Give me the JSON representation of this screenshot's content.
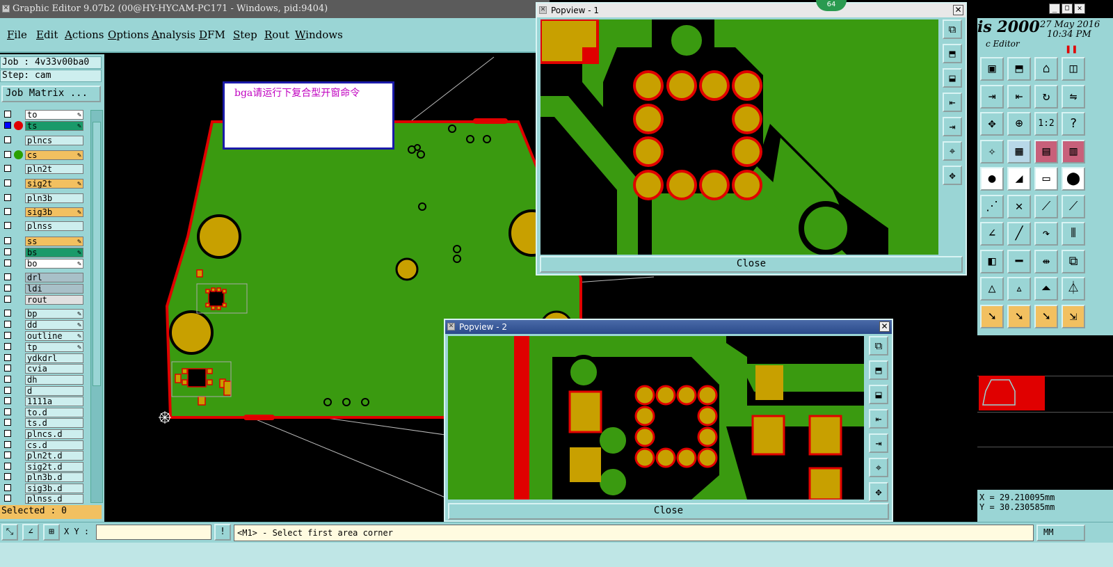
{
  "app": {
    "title": "Graphic Editor 9.07b2 (00@HY-HYCAM-PC171 - Windows, pid:9404)",
    "brand_fragment": "is 2000",
    "brand_sub": "c Editor",
    "date": "27 May 2016",
    "time": "10:34 PM",
    "badge": "64"
  },
  "menu": [
    "File",
    "Edit",
    "Actions",
    "Options",
    "Analysis",
    "DFM",
    "Step",
    "Rout",
    "Windows"
  ],
  "job": {
    "job_label": "Job : 4v33v00ba0",
    "step_label": "Step: cam",
    "matrix_button": "Job Matrix ..."
  },
  "layers": [
    {
      "name": "to",
      "color": "#ffffff",
      "edit": true,
      "dot": ""
    },
    {
      "name": "ts",
      "color": "#1a9a6a",
      "edit": true,
      "dot": "#e00000",
      "selected": true
    },
    {
      "name": "plncs",
      "color": "#cdeeee",
      "edit": false,
      "dot": ""
    },
    {
      "name": "cs",
      "color": "#f2c060",
      "edit": true,
      "dot": "#2aa000"
    },
    {
      "name": "pln2t",
      "color": "#cdeeee",
      "edit": false,
      "dot": ""
    },
    {
      "name": "sig2t",
      "color": "#f2c060",
      "edit": true,
      "dot": ""
    },
    {
      "name": "pln3b",
      "color": "#cdeeee",
      "edit": false,
      "dot": ""
    },
    {
      "name": "sig3b",
      "color": "#f2c060",
      "edit": true,
      "dot": ""
    },
    {
      "name": "plnss",
      "color": "#cdeeee",
      "edit": false,
      "dot": ""
    },
    {
      "name": "ss",
      "color": "#f2c060",
      "edit": true,
      "dot": ""
    },
    {
      "name": "bs",
      "color": "#1a9a6a",
      "edit": true,
      "dot": ""
    },
    {
      "name": "bo",
      "color": "#ffffff",
      "edit": true,
      "dot": ""
    },
    {
      "name": "drl",
      "color": "#a8c0c8",
      "edit": false,
      "dot": ""
    },
    {
      "name": "ldi",
      "color": "#a8c0c8",
      "edit": false,
      "dot": ""
    },
    {
      "name": "rout",
      "color": "#e0e0e0",
      "edit": false,
      "dot": ""
    },
    {
      "name": "bp",
      "color": "#cdeeee",
      "edit": true,
      "dot": ""
    },
    {
      "name": "dd",
      "color": "#cdeeee",
      "edit": true,
      "dot": ""
    },
    {
      "name": "outline",
      "color": "#cdeeee",
      "edit": true,
      "dot": ""
    },
    {
      "name": "tp",
      "color": "#cdeeee",
      "edit": true,
      "dot": ""
    },
    {
      "name": "ydkdrl",
      "color": "#cdeeee",
      "edit": false,
      "dot": ""
    },
    {
      "name": "cvia",
      "color": "#cdeeee",
      "edit": false,
      "dot": ""
    },
    {
      "name": "dh",
      "color": "#cdeeee",
      "edit": false,
      "dot": ""
    },
    {
      "name": "d",
      "color": "#cdeeee",
      "edit": false,
      "dot": ""
    },
    {
      "name": "1111a",
      "color": "#cdeeee",
      "edit": false,
      "dot": ""
    },
    {
      "name": "to.d",
      "color": "#cdeeee",
      "edit": false,
      "dot": ""
    },
    {
      "name": "ts.d",
      "color": "#cdeeee",
      "edit": false,
      "dot": ""
    },
    {
      "name": "plncs.d",
      "color": "#cdeeee",
      "edit": false,
      "dot": ""
    },
    {
      "name": "cs.d",
      "color": "#cdeeee",
      "edit": false,
      "dot": ""
    },
    {
      "name": "pln2t.d",
      "color": "#cdeeee",
      "edit": false,
      "dot": ""
    },
    {
      "name": "sig2t.d",
      "color": "#cdeeee",
      "edit": false,
      "dot": ""
    },
    {
      "name": "pln3b.d",
      "color": "#cdeeee",
      "edit": false,
      "dot": ""
    },
    {
      "name": "sig3b.d",
      "color": "#cdeeee",
      "edit": false,
      "dot": ""
    },
    {
      "name": "plnss.d",
      "color": "#cdeeee",
      "edit": false,
      "dot": ""
    }
  ],
  "selected_label": "Selected : 0",
  "note_text": "bga请运行下复合型开窗命令",
  "popview1": {
    "title": "Popview - 1",
    "close_label": "Close"
  },
  "popview2": {
    "title": "Popview - 2",
    "close_label": "Close"
  },
  "coords": {
    "x": "X = 29.210095mm",
    "y": "Y = 30.230585mm"
  },
  "status": {
    "xy_label": "X Y :",
    "xy_value": "",
    "prompt": "<M1> - Select first area corner",
    "units": "MM"
  },
  "colors": {
    "board": "#3a9a10",
    "pad": "#c8a000",
    "outline": "#e00000",
    "panel": "#9ad5d5"
  }
}
